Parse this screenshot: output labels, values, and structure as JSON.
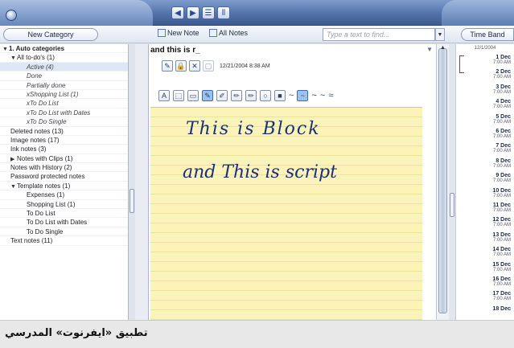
{
  "toolbar": {
    "new_category": "New Category",
    "new_note": "New Note",
    "all_notes": "All Notes",
    "search_placeholder": "Type a text to find...",
    "time_band": "Time Band"
  },
  "sidebar": {
    "items": [
      {
        "label": "1. Auto categories",
        "level": 0,
        "arrow": "▼",
        "bold": true
      },
      {
        "label": "All to-do's (1)",
        "level": 1,
        "arrow": "▼"
      },
      {
        "label": "Active (4)",
        "level": 2,
        "italic": true,
        "selected": true
      },
      {
        "label": "Done",
        "level": 2,
        "italic": true
      },
      {
        "label": "Partially done",
        "level": 2,
        "italic": true
      },
      {
        "label": "xShopping List (1)",
        "level": 2,
        "italic": true
      },
      {
        "label": "xTo Do List",
        "level": 2,
        "italic": true
      },
      {
        "label": "xTo Do List with Dates",
        "level": 2,
        "italic": true
      },
      {
        "label": "xTo Do Single",
        "level": 2,
        "italic": true
      },
      {
        "label": "Deleted notes (13)",
        "level": 1
      },
      {
        "label": "Image notes (17)",
        "level": 1
      },
      {
        "label": "Ink notes (3)",
        "level": 1
      },
      {
        "label": "Notes with Clips (1)",
        "level": 1,
        "arrow": "▶"
      },
      {
        "label": "Notes with History (2)",
        "level": 1
      },
      {
        "label": "Password protected notes",
        "level": 1
      },
      {
        "label": "Template notes (1)",
        "level": 1,
        "arrow": "▼"
      },
      {
        "label": "Expenses (1)",
        "level": 2
      },
      {
        "label": "Shopping List (1)",
        "level": 2
      },
      {
        "label": "To Do List",
        "level": 2
      },
      {
        "label": "To Do List with Dates",
        "level": 2
      },
      {
        "label": "To Do Single",
        "level": 2
      },
      {
        "label": "Text notes (11)",
        "level": 1
      }
    ]
  },
  "note": {
    "title": "and this is r_",
    "date": "12/21/2004 8:38 AM",
    "ink_line1": "This is Block",
    "ink_line2": "and This is script"
  },
  "timeband": {
    "header": "12/1/2004",
    "entries": [
      {
        "day": "1 Dec",
        "time": "7:00 AM"
      },
      {
        "day": "2 Dec",
        "time": "7:00 AM"
      },
      {
        "day": "3 Dec",
        "time": "7:00 AM"
      },
      {
        "day": "4 Dec",
        "time": "7:00 AM"
      },
      {
        "day": "5 Dec",
        "time": "7:00 AM"
      },
      {
        "day": "6 Dec",
        "time": "7:00 AM"
      },
      {
        "day": "7 Dec",
        "time": "7:00 AM"
      },
      {
        "day": "8 Dec",
        "time": "7:00 AM"
      },
      {
        "day": "9 Dec",
        "time": "7:00 AM"
      },
      {
        "day": "10 Dec",
        "time": "7:00 AM"
      },
      {
        "day": "11 Dec",
        "time": "7:00 AM"
      },
      {
        "day": "12 Dec",
        "time": "7:00 AM"
      },
      {
        "day": "13 Dec",
        "time": "7:00 AM"
      },
      {
        "day": "14 Dec",
        "time": "7:00 AM"
      },
      {
        "day": "15 Dec",
        "time": "7:00 AM"
      },
      {
        "day": "16 Dec",
        "time": "7:00 AM"
      },
      {
        "day": "17 Dec",
        "time": "7:00 AM"
      },
      {
        "day": "18 Dec",
        "time": ""
      }
    ]
  },
  "caption": "تطبيق «ايفرنوت» المدرسي"
}
